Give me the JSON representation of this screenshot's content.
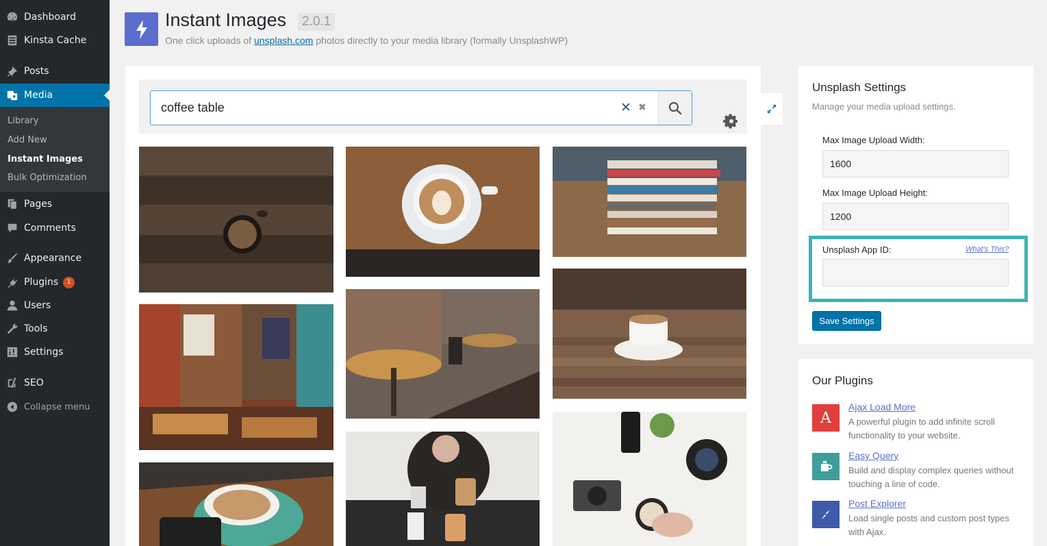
{
  "sidebar": {
    "items": [
      {
        "label": "Dashboard",
        "icon": "dashboard-icon"
      },
      {
        "label": "Kinsta Cache",
        "icon": "server-icon"
      },
      {
        "label": "Posts",
        "icon": "pushpin-icon"
      },
      {
        "label": "Media",
        "icon": "media-icon"
      },
      {
        "label": "Pages",
        "icon": "pages-icon"
      },
      {
        "label": "Comments",
        "icon": "comment-icon"
      },
      {
        "label": "Appearance",
        "icon": "brush-icon"
      },
      {
        "label": "Plugins",
        "icon": "plug-icon",
        "badge": "1"
      },
      {
        "label": "Users",
        "icon": "user-icon"
      },
      {
        "label": "Tools",
        "icon": "wrench-icon"
      },
      {
        "label": "Settings",
        "icon": "sliders-icon"
      },
      {
        "label": "SEO",
        "icon": "seo-icon"
      }
    ],
    "media_submenu": [
      "Library",
      "Add New",
      "Instant Images",
      "Bulk Optimization"
    ],
    "collapse_label": "Collapse menu",
    "accent": "#0073aa"
  },
  "header": {
    "title": "Instant Images",
    "version": "2.0.1",
    "tagline_before": "One click uploads of ",
    "tagline_link": "unsplash.com",
    "tagline_after": " photos directly to your media library (formally UnsplashWP)"
  },
  "search": {
    "value": "coffee table",
    "placeholder": ""
  },
  "settings": {
    "title": "Unsplash Settings",
    "description": "Manage your media upload settings.",
    "max_width_label": "Max Image Upload Width:",
    "max_width_value": "1600",
    "max_height_label": "Max Image Upload Height:",
    "max_height_value": "1200",
    "app_id_label": "Unsplash App ID:",
    "app_id_value": "",
    "whats_this": "What's This?",
    "save_label": "Save Settings",
    "highlight_color": "#3cb4b5"
  },
  "our_plugins": {
    "title": "Our Plugins",
    "items": [
      {
        "name": "Ajax Load More",
        "desc": "A powerful plugin to add infinite scroll functionality to your website.",
        "icon_letter": "A",
        "color": "#e13f3f"
      },
      {
        "name": "Easy Query",
        "desc": "Build and display complex queries without touching a line of code.",
        "icon_letter": "",
        "color": "#3f9e9a"
      },
      {
        "name": "Post Explorer",
        "desc": "Load single posts and custom post types with Ajax.",
        "icon_letter": "",
        "color": "#3e5aa8"
      }
    ]
  }
}
